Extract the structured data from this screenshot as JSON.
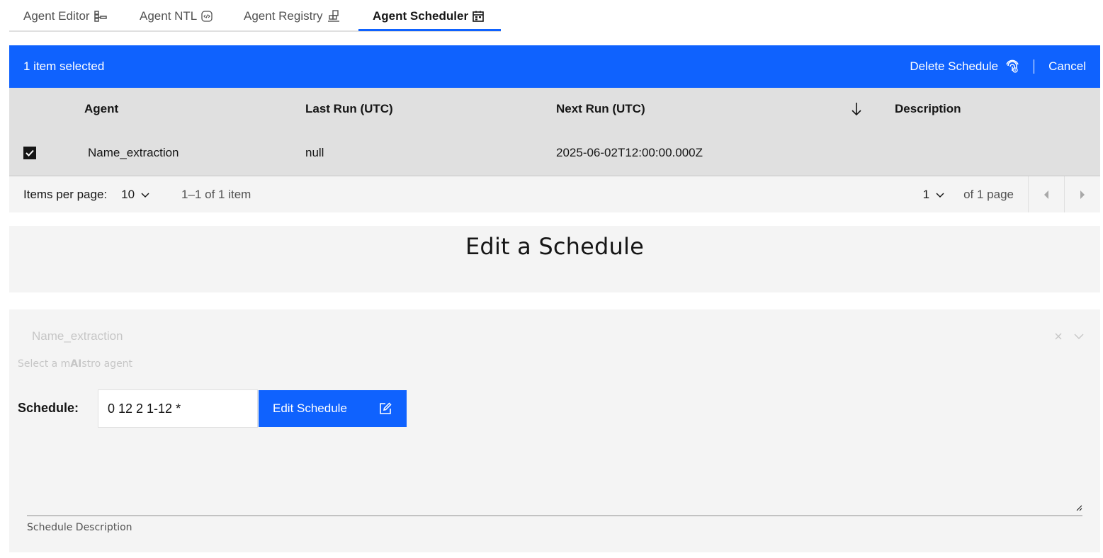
{
  "tabs": [
    {
      "label": "Agent Editor",
      "icon": "flow-icon"
    },
    {
      "label": "Agent NTL",
      "icon": "code-icon"
    },
    {
      "label": "Agent Registry",
      "icon": "registry-icon"
    },
    {
      "label": "Agent Scheduler",
      "icon": "calendar-icon"
    }
  ],
  "active_tab": "Agent Scheduler",
  "batch": {
    "selected_text": "1 item selected",
    "delete_label": "Delete Schedule",
    "cancel_label": "Cancel"
  },
  "table": {
    "headers": [
      "Agent",
      "Last Run (UTC)",
      "Next Run (UTC)",
      "Description"
    ],
    "rows": [
      {
        "agent": "Name_extraction",
        "last_run": "null",
        "next_run": "2025-06-02T12:00:00.000Z",
        "description": "",
        "selected": true
      }
    ]
  },
  "pagination": {
    "items_per_page_label": "Items per page:",
    "items_per_page": "10",
    "range_text": "1–1 of 1 item",
    "page": "1",
    "of_pages": "of 1 page"
  },
  "editor": {
    "title": "Edit a Schedule",
    "agent_value": "Name_extraction",
    "helper_prefix": "Select a m",
    "helper_bold": "AI",
    "helper_suffix": "stro agent",
    "schedule_label": "Schedule:",
    "schedule_value": "0 12 2 1-12 *",
    "edit_button": "Edit Schedule",
    "description_label": "Schedule Description"
  },
  "colors": {
    "primary": "#0f62fe",
    "header_bg": "#e0e0e0",
    "panel_bg": "#f4f4f4"
  }
}
